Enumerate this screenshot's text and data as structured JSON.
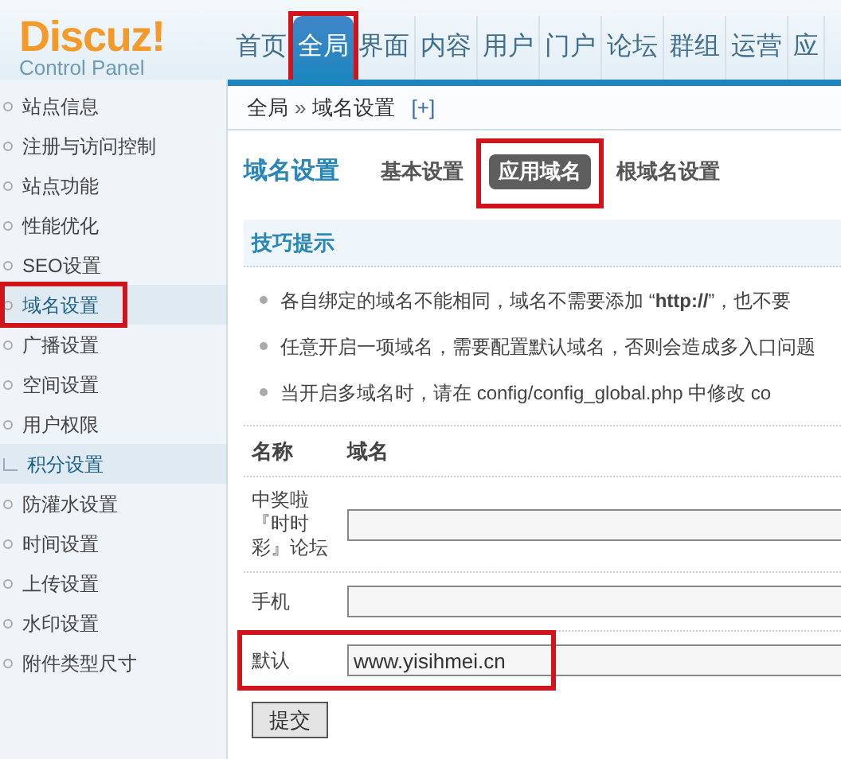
{
  "logo": {
    "name": "Discuz!",
    "subtitle": "Control Panel"
  },
  "nav": [
    {
      "label": "首页",
      "selected": false,
      "highlighted": false
    },
    {
      "label": "全局",
      "selected": true,
      "highlighted": true
    },
    {
      "label": "界面",
      "selected": false,
      "highlighted": false
    },
    {
      "label": "内容",
      "selected": false,
      "highlighted": false
    },
    {
      "label": "用户",
      "selected": false,
      "highlighted": false
    },
    {
      "label": "门户",
      "selected": false,
      "highlighted": false
    },
    {
      "label": "论坛",
      "selected": false,
      "highlighted": false
    },
    {
      "label": "群组",
      "selected": false,
      "highlighted": false
    },
    {
      "label": "运营",
      "selected": false,
      "highlighted": false
    },
    {
      "label": "应",
      "selected": false,
      "highlighted": false
    }
  ],
  "breadcrumb": {
    "root": "全局",
    "separator": "»",
    "current": "域名设置",
    "add": "[+]"
  },
  "sidebar": {
    "items": [
      {
        "label": "站点信息",
        "kind": "page",
        "selected": false,
        "highlighted": false
      },
      {
        "label": "注册与访问控制",
        "kind": "page",
        "selected": false,
        "highlighted": false
      },
      {
        "label": "站点功能",
        "kind": "page",
        "selected": false,
        "highlighted": false
      },
      {
        "label": "性能优化",
        "kind": "page",
        "selected": false,
        "highlighted": false
      },
      {
        "label": "SEO设置",
        "kind": "page",
        "selected": false,
        "highlighted": false
      },
      {
        "label": "域名设置",
        "kind": "page",
        "selected": true,
        "highlighted": true
      },
      {
        "label": "广播设置",
        "kind": "page",
        "selected": false,
        "highlighted": false
      },
      {
        "label": "空间设置",
        "kind": "page",
        "selected": false,
        "highlighted": false
      },
      {
        "label": "用户权限",
        "kind": "page",
        "selected": false,
        "highlighted": false
      },
      {
        "label": "积分设置",
        "kind": "link",
        "selected": false,
        "highlighted": false
      },
      {
        "label": "防灌水设置",
        "kind": "page",
        "selected": false,
        "highlighted": false
      },
      {
        "label": "时间设置",
        "kind": "page",
        "selected": false,
        "highlighted": false
      },
      {
        "label": "上传设置",
        "kind": "page",
        "selected": false,
        "highlighted": false
      },
      {
        "label": "水印设置",
        "kind": "page",
        "selected": false,
        "highlighted": false
      },
      {
        "label": "附件类型尺寸",
        "kind": "page",
        "selected": false,
        "highlighted": false
      }
    ]
  },
  "page_title": "域名设置",
  "subtabs": [
    {
      "label": "基本设置",
      "selected": false,
      "highlighted": false
    },
    {
      "label": "应用域名",
      "selected": true,
      "highlighted": true
    },
    {
      "label": "根域名设置",
      "selected": false,
      "highlighted": false
    }
  ],
  "tips": {
    "title": "技巧提示",
    "items": [
      "各自绑定的域名不能相同，域名不需要添加 “**http://**”，也不要",
      "任意开启一项域名，需要配置默认域名，否则会造成多入口问题",
      "当开启多域名时，请在 config/config_global.php 中修改 co"
    ]
  },
  "table": {
    "columns": [
      "名称",
      "域名"
    ],
    "rows": [
      {
        "name": "中奖啦『时时彩』论坛",
        "value": "",
        "highlighted": false
      },
      {
        "name": "手机",
        "value": "",
        "highlighted": false
      },
      {
        "name": "默认",
        "value": "www.yisihmei.cn",
        "highlighted": true
      }
    ]
  },
  "submit": "提交"
}
